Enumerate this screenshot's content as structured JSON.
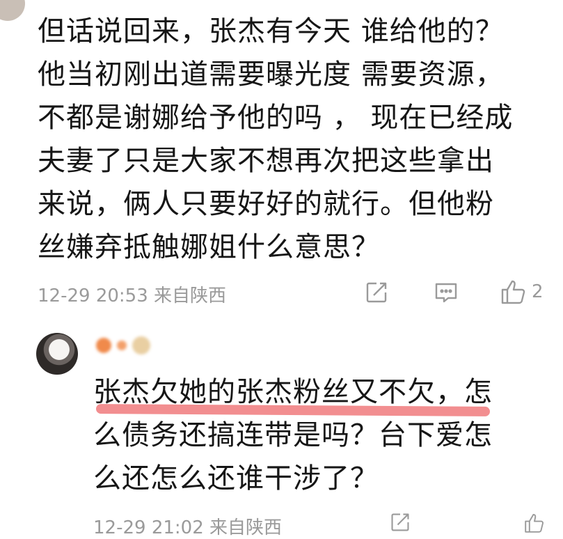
{
  "comment": {
    "lines": [
      "但话说回来，张杰有今天 谁给他的？",
      "他当初刚出道需要曝光度 需要资源，",
      "不都是谢娜给予他的吗  ，  现在已经成",
      "夫妻了只是大家不想再次把这些拿出",
      "来说，俩人只要好好的就行。但他粉",
      "丝嫌弃抵触娜姐什么意思？"
    ],
    "timestamp": "12-29 20:53",
    "location": "来自陕西",
    "like_count": "2",
    "icons": [
      "share-icon",
      "comment-icon",
      "like-icon"
    ]
  },
  "reply": {
    "lines": [
      "张杰欠她的张杰粉丝又不欠，怎",
      "么债务还搞连带是吗？台下爱怎",
      "么还怎么还谁干涉了？"
    ],
    "timestamp": "12-29 21:02",
    "location": "来自陕西",
    "icons": [
      "share-icon",
      "like-icon"
    ],
    "highlight_color": "#f07a7c"
  }
}
